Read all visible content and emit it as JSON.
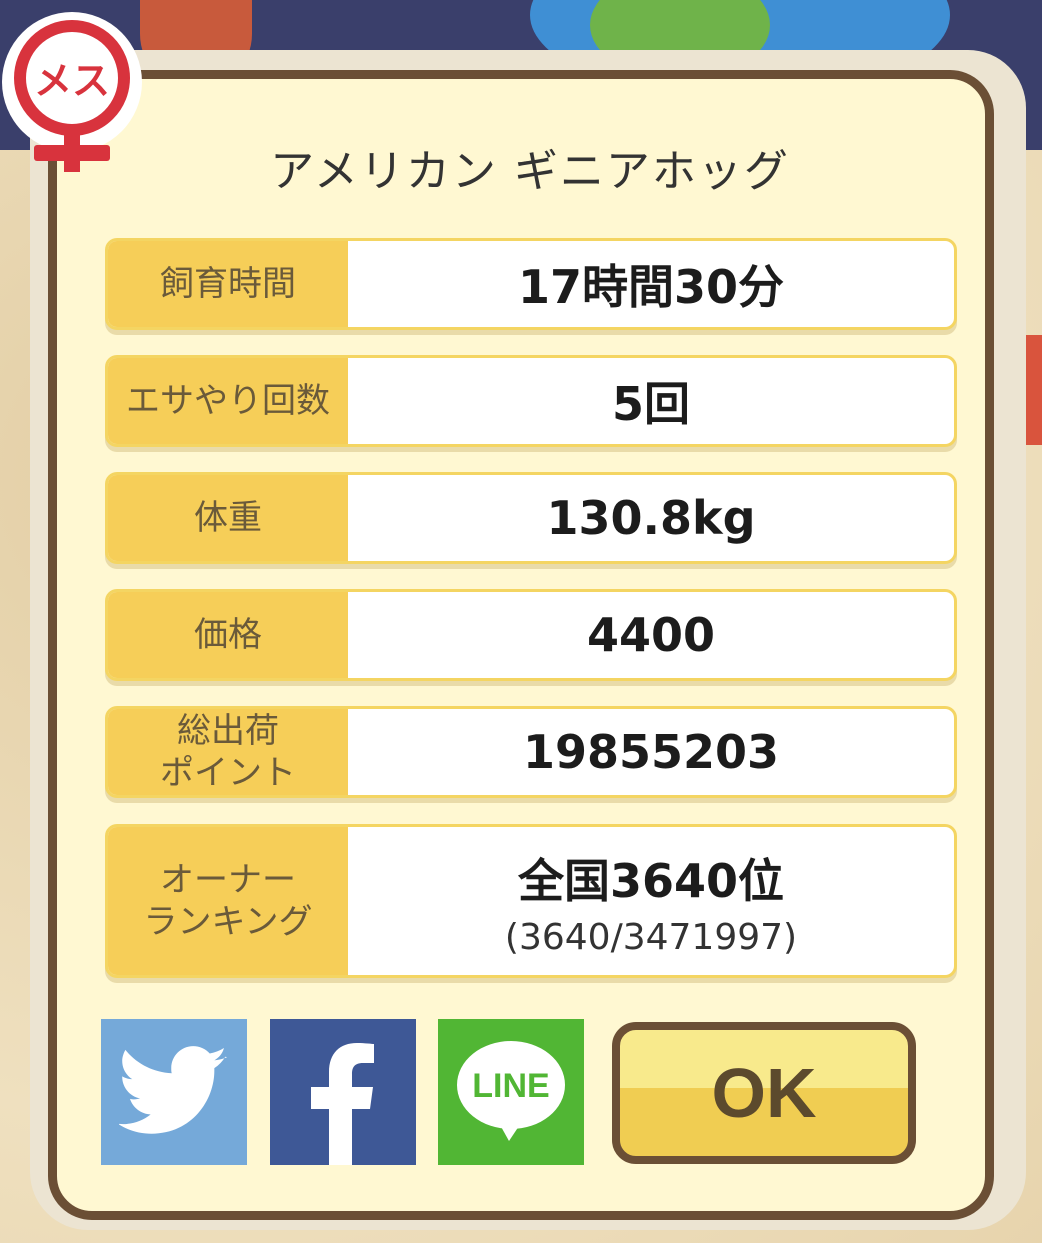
{
  "title": "アメリカン ギニアホッグ",
  "gender_badge": {
    "label": "メス",
    "color": "#d8333d"
  },
  "stats": [
    {
      "label": "飼育時間",
      "value": "17時間30分"
    },
    {
      "label": "エサやり回数",
      "value": "5回"
    },
    {
      "label": "体重",
      "value": "130.8kg"
    },
    {
      "label": "価格",
      "value": "4400"
    },
    {
      "label": "総出荷\nポイント",
      "value": "19855203"
    },
    {
      "label": "オーナー\nランキング",
      "value": "全国3640位",
      "sub": "(3640/3471997)"
    }
  ],
  "share": {
    "twitter": {
      "icon": "twitter-bird-icon",
      "color": "#75a9d9"
    },
    "facebook": {
      "icon": "facebook-f-icon",
      "color": "#3e5896"
    },
    "line": {
      "icon": "line-logo-icon",
      "label": "LINE",
      "color": "#51b634"
    }
  },
  "ok_label": "OK",
  "colors": {
    "label_bg": "#f6ce58",
    "border": "#6b4f35",
    "panel": "#fff8d2"
  }
}
